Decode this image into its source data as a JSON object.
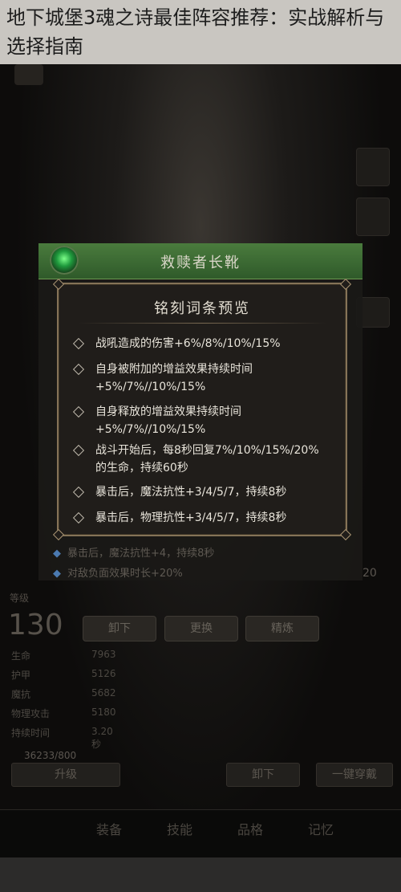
{
  "title": "地下城堡3魂之诗最佳阵容推荐：实战解析与选择指南",
  "item": {
    "name": "救赎者长靴"
  },
  "preview": {
    "title": "铭刻词条预览",
    "entries": [
      "战吼造成的伤害+6%/8%/10%/15%",
      "自身被附加的增益效果持续时间+5%/7%//10%/15%",
      "自身释放的增益效果持续时间+5%/7%//10%/15%",
      "战斗开始后，每8秒回复7%/10%/15%/20%的生命，持续60秒",
      "暴击后，魔法抗性+3/4/5/7，持续8秒",
      "暴击后，物理抗性+3/4/5/7，持续8秒"
    ]
  },
  "underlying_attributes": [
    "暴击后，魔法抗性+4，持续8秒",
    "对敌负面效果时长+20%"
  ],
  "level": {
    "label": "等级",
    "value": "130"
  },
  "actions": {
    "unequip": "卸下",
    "replace": "更换",
    "refine": "精炼"
  },
  "stats": [
    {
      "name": "生命",
      "value": "7963"
    },
    {
      "name": "护甲",
      "value": "5126"
    },
    {
      "name": "魔抗",
      "value": "5682"
    },
    {
      "name": "物理攻击",
      "value": "5180"
    },
    {
      "name": "持续时间",
      "value": "3.20秒"
    }
  ],
  "currency": "36233/800",
  "bottom_buttons": {
    "upgrade": "升级",
    "unequip": "卸下",
    "one_click": "一键穿戴"
  },
  "nav": [
    "装备",
    "技能",
    "品格",
    "记忆"
  ],
  "side_badge": "20",
  "colors": {
    "header_green": "#3d6b35",
    "dialog_border": "#857357",
    "title_band": "#c9c6c1"
  }
}
